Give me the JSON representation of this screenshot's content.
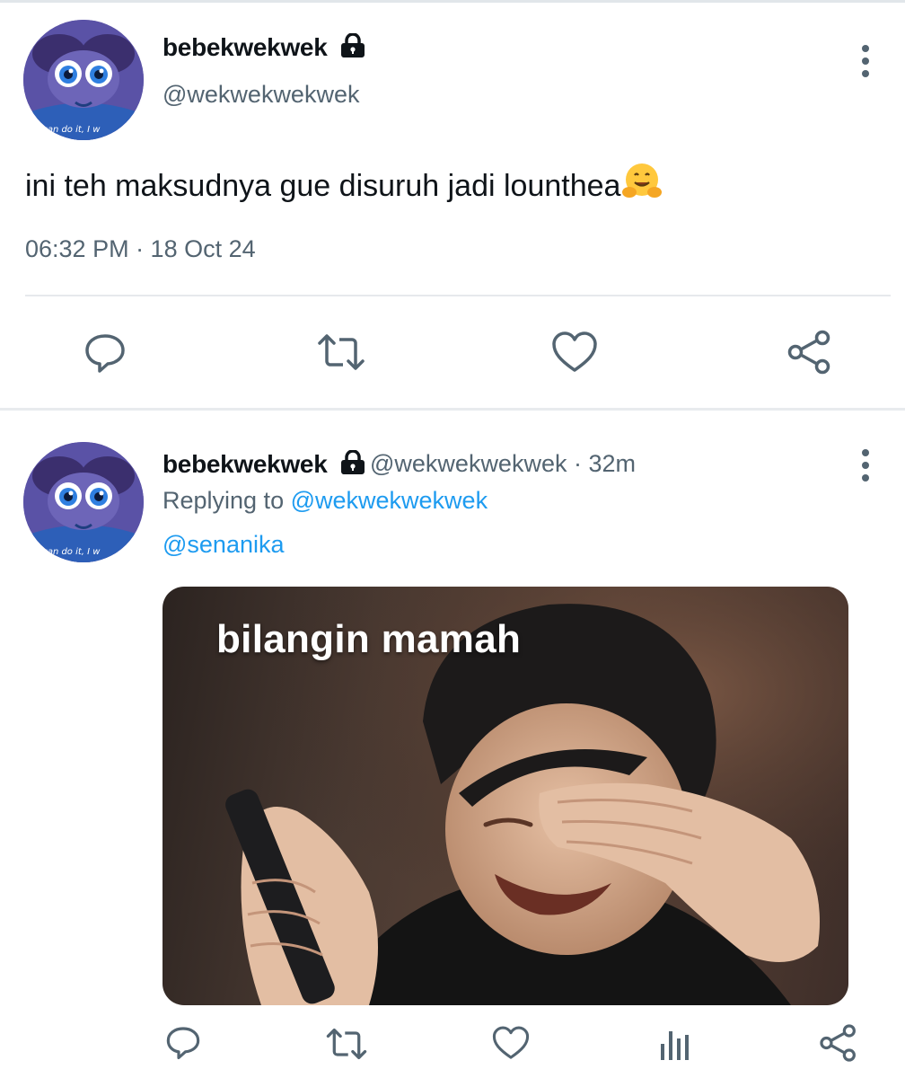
{
  "colors": {
    "text_primary": "#0f1419",
    "text_secondary": "#536471",
    "link": "#1d9bf0",
    "divider": "#e8ebee"
  },
  "main_tweet": {
    "display_name": "bebekwekwek",
    "handle": "@wekwekwekwek",
    "text": "ini teh maksudnya gue disuruh jadi lounthea",
    "emoji": "hugging-face-emoji",
    "timestamp": "06:32 PM · 18 Oct 24",
    "avatar_caption": "w i can do it, I w",
    "actions": [
      "reply-icon",
      "retweet-icon",
      "like-icon",
      "share-icon"
    ]
  },
  "reply_tweet": {
    "display_name": "bebekwekwek",
    "handle_time": "@wekwekwekwek · 32m",
    "replying_to_label": "Replying to",
    "replying_to_handle": "@wekwekwekwek",
    "mention": "@senanika",
    "avatar_caption": "w i can do it, I w",
    "media_caption": "bilangin mamah",
    "actions": [
      "reply-icon",
      "retweet-icon",
      "like-icon",
      "views-icon",
      "share-icon"
    ]
  }
}
